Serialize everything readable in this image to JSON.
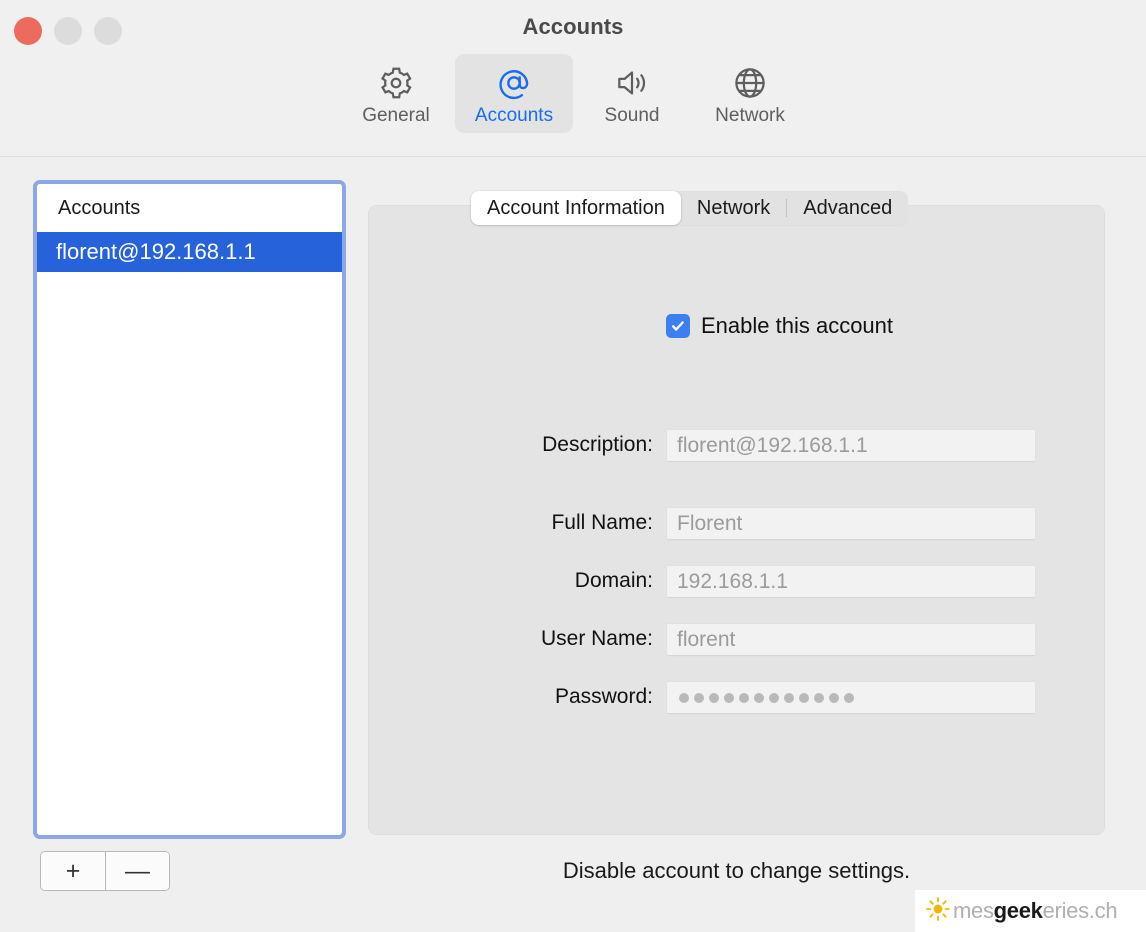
{
  "window": {
    "title": "Accounts",
    "traffic_lights": [
      {
        "name": "close",
        "color": "#ed6a5e"
      },
      {
        "name": "minimize",
        "color": "#dcdcdc"
      },
      {
        "name": "maximize",
        "color": "#dcdcdc"
      }
    ]
  },
  "toolbar": {
    "items": [
      {
        "label": "General",
        "icon": "gear-icon",
        "selected": false
      },
      {
        "label": "Accounts",
        "icon": "at-sign-icon",
        "selected": true
      },
      {
        "label": "Sound",
        "icon": "speaker-icon",
        "selected": false
      },
      {
        "label": "Network",
        "icon": "globe-icon",
        "selected": false
      }
    ],
    "accent_color": "#1a6bf2",
    "selected_bg": "#e3e3e3"
  },
  "sidebar": {
    "header": "Accounts",
    "rows": [
      {
        "label": "florent@192.168.1.1",
        "selected": true
      }
    ],
    "selection_color": "#2662d9",
    "focus_ring_color": "#8ca6e8",
    "add_button": "+",
    "remove_button": "—"
  },
  "tabs": [
    {
      "label": "Account Information",
      "selected": true
    },
    {
      "label": "Network",
      "selected": false
    },
    {
      "label": "Advanced",
      "selected": false
    }
  ],
  "account": {
    "enable_checkbox": {
      "label": "Enable this account",
      "checked": true,
      "color": "#3d7ef0"
    },
    "fields": [
      {
        "label": "Description:",
        "value": "florent@192.168.1.1",
        "type": "text",
        "disabled": true
      },
      {
        "label": "Full Name:",
        "value": "Florent",
        "type": "text",
        "disabled": true
      },
      {
        "label": "Domain:",
        "value": "192.168.1.1",
        "type": "text",
        "disabled": true
      },
      {
        "label": "User Name:",
        "value": "florent",
        "type": "text",
        "disabled": true
      },
      {
        "label": "Password:",
        "value": "",
        "type": "password",
        "dots": 12,
        "disabled": true
      }
    ]
  },
  "footer": {
    "note": "Disable account to change settings."
  },
  "watermark": {
    "prefix": "mes",
    "bold": "geek",
    "suffix": "eries.ch",
    "icon": "sun-icon"
  }
}
